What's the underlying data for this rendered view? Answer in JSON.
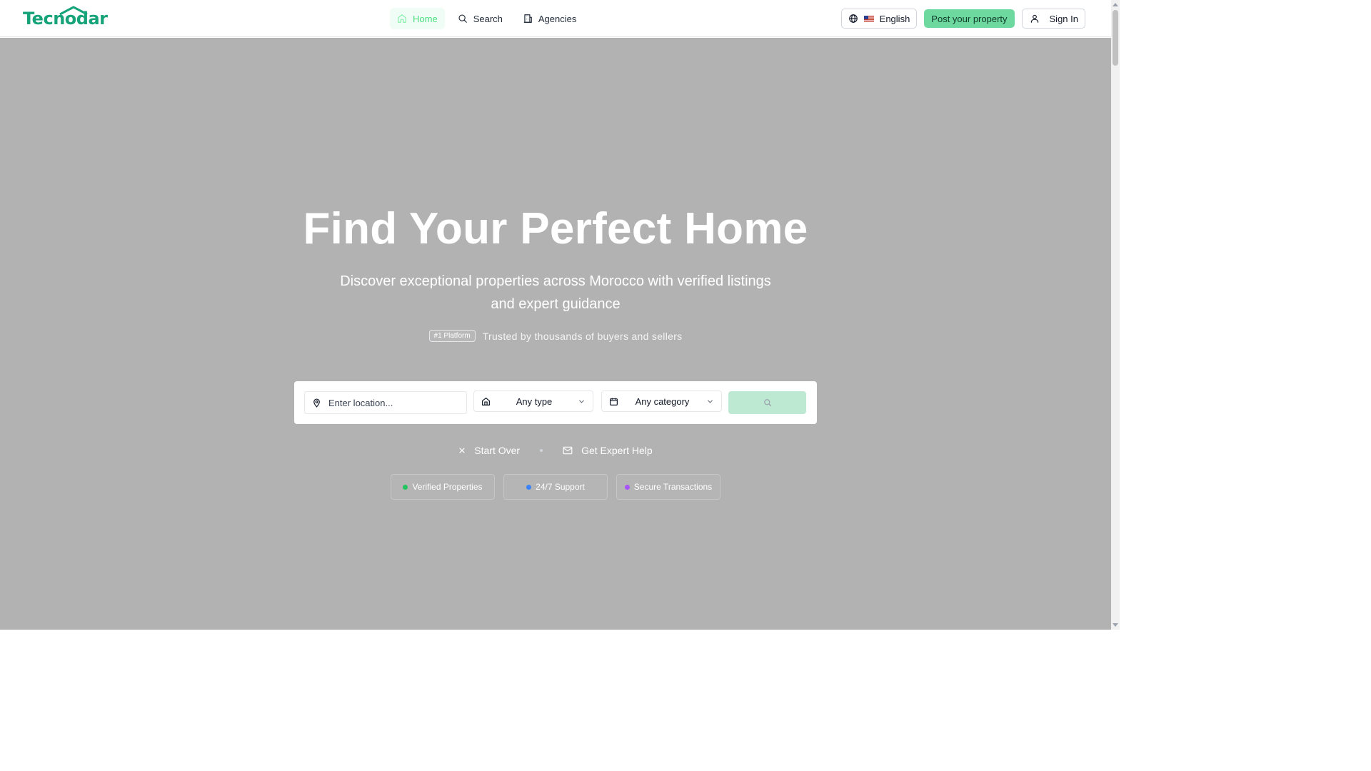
{
  "header": {
    "logo": "Tecnodar",
    "nav": [
      {
        "label": "Home",
        "icon": "home-icon",
        "active": true
      },
      {
        "label": "Search",
        "icon": "search-icon",
        "active": false
      },
      {
        "label": "Agencies",
        "icon": "building-icon",
        "active": false
      }
    ],
    "language": "English",
    "post_property": "Post your property",
    "sign_in": "Sign In"
  },
  "hero": {
    "title": "Find Your Perfect Home",
    "subtitle": "Discover exceptional properties across Morocco with verified listings and expert guidance",
    "badge": "#1 Platform",
    "trust_text": "Trusted by thousands of buyers and sellers"
  },
  "search": {
    "location_placeholder": "Enter location...",
    "type": "Any type",
    "category": "Any category"
  },
  "links": {
    "start_over": "Start Over",
    "expert_help": "Get Expert Help"
  },
  "features": [
    {
      "label": "Verified Properties",
      "color": "#22c55e"
    },
    {
      "label": "24/7 Support",
      "color": "#3b82f6"
    },
    {
      "label": "Secure Transactions",
      "color": "#a855f7"
    }
  ],
  "colors": {
    "brand": "#16a37a",
    "primary_button": "#6ed99f",
    "hero_background": "#b2b2b2"
  }
}
